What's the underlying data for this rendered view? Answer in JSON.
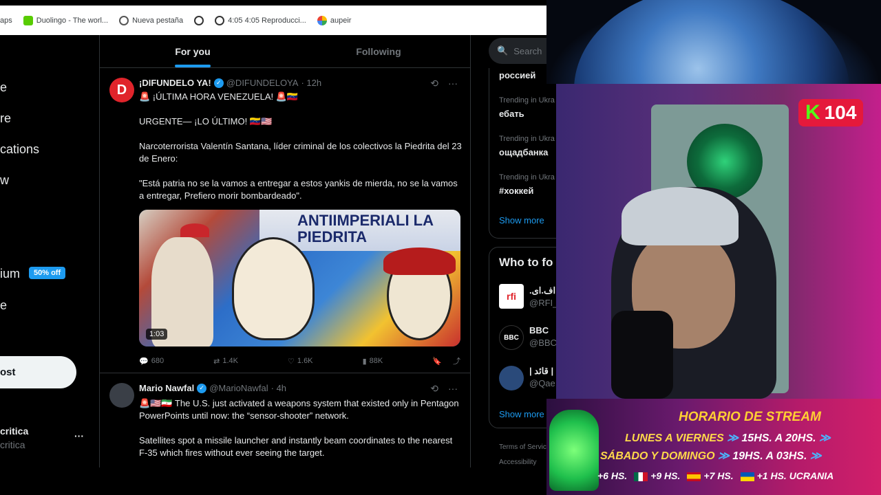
{
  "bookmarks": [
    {
      "label": "aps",
      "icon": "map-icon"
    },
    {
      "label": "Duolingo - The worl...",
      "icon": "duolingo-icon"
    },
    {
      "label": "Nueva pestaña",
      "icon": "chrome-icon"
    },
    {
      "label": "",
      "icon": "globe-icon"
    },
    {
      "label": "4:05 4:05 Reproducci...",
      "icon": "globe-icon"
    },
    {
      "label": "aupeir",
      "icon": "puzzle-icon"
    }
  ],
  "left_nav": {
    "items": [
      "e",
      "re",
      "cations",
      "w",
      "ium",
      "e"
    ],
    "premium_badge": "50% off",
    "post_button": "ost",
    "account_name": "critica",
    "account_handle": "critica",
    "more": "···"
  },
  "tabs": {
    "for_you": "For you",
    "following": "Following"
  },
  "tweet1": {
    "avatar_letter": "D",
    "name": "¡DIFUNDELO YA!",
    "handle": "@DIFUNDELOYA",
    "time": "· 12h",
    "line1": "🚨 ¡ÚLTIMA HORA VENEZUELA! 🚨🇻🇪",
    "line2": "URGENTE— ¡LO ÚLTIMO! 🇻🇪🇺🇸",
    "line3": "Narcoterrorista Valentín Santana, líder criminal de los colectivos la Piedrita del 23 de Enero:",
    "line4": "\"Está patria no se la vamos a entregar a estos yankis de mierda, no se la vamos a entregar, Prefiero morir bombardeado\".",
    "media_banner": "ANTIIMPERIALI LA PIEDRITA",
    "duration": "1:03",
    "replies": "680",
    "reposts": "1.4K",
    "likes": "1.6K",
    "views": "88K"
  },
  "tweet2": {
    "name": "Mario Nawfal",
    "handle": "@MarioNawfal",
    "time": "· 4h",
    "line1": "🚨🇺🇸🇮🇷 The U.S. just activated a weapons system that existed only in Pentagon PowerPoints until now: the “sensor-shooter” network.",
    "line2": "Satellites spot a missile launcher and instantly beam coordinates to the nearest F-35 which fires without ever seeing the target."
  },
  "right_col": {
    "search_placeholder": "Search",
    "trends": [
      {
        "meta": "",
        "name": "россией"
      },
      {
        "meta": "Trending in Ukra",
        "name": "ебать"
      },
      {
        "meta": "Trending in Ukra",
        "name": "ощадбанка"
      },
      {
        "meta": "Trending in Ukra",
        "name": "#хоккей"
      }
    ],
    "show_more": "Show more",
    "who_to_follow": "Who to fo",
    "accounts": [
      {
        "name": ".اف.ای",
        "handle": "@RFI_"
      },
      {
        "name": "BBC",
        "handle": "@BBC"
      },
      {
        "name": "| قائد |",
        "handle": "@Qae"
      }
    ],
    "show_more_2": "Show more",
    "footer1": "Terms of Servic",
    "footer2": "Accessibility"
  },
  "stream": {
    "kick_count": "104",
    "kick_letter": "K",
    "schedule_title": "HORARIO DE STREAM",
    "row1_days": "LUNES A VIERNES",
    "row1_time": "15HS. A 20HS.",
    "row2_days": "SÁBADO Y DOMINGO",
    "row2_time": "19HS. A 03HS.",
    "tz1": "+6 HS.",
    "tz2": "+9 HS.",
    "tz3": "+7 HS.",
    "tz4": "+1 HS. UCRANIA"
  },
  "colors": {
    "accent": "#1d9bf0",
    "kick_green": "#53fc18",
    "schedule_yellow": "#ffcf33"
  }
}
